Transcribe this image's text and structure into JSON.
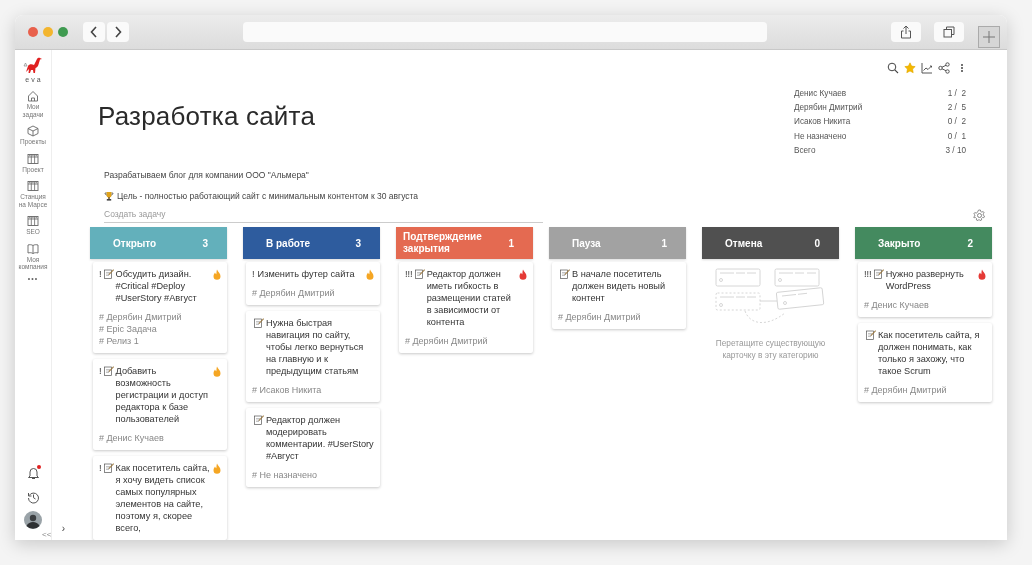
{
  "sidebar": {
    "logo_text": "eva",
    "items": [
      {
        "label": "Мои задачи"
      },
      {
        "label": "Проекты"
      },
      {
        "label": "Проект"
      },
      {
        "label": "Станция на Марсе"
      },
      {
        "label": "SEO"
      },
      {
        "label": "Моя компания"
      }
    ],
    "more": "•••",
    "unread": true,
    "expand": "›",
    "collapse": "<<"
  },
  "project": {
    "title": "Разработка сайта",
    "description": "Разрабатываем блог для компании ООО \"Альмера\"",
    "goal": "Цель - полностью работающий сайт с минимальным контентом к 30 августа"
  },
  "toolbar": {
    "favorite": true
  },
  "stats": [
    {
      "name": "Денис Кучаев",
      "value": "1 /  2"
    },
    {
      "name": "Дерябин Дмитрий",
      "value": "2 /  5"
    },
    {
      "name": "Исаков Никита",
      "value": "0 /  2"
    },
    {
      "name": "Не назначено",
      "value": "0 /  1"
    },
    {
      "name": "Всего",
      "value": "3 / 10"
    }
  ],
  "create_task": {
    "placeholder": "Создать задачу"
  },
  "columns": [
    {
      "title": "Открыто",
      "count": "3",
      "color": "#63b0bb",
      "cards": [
        {
          "priority": "!",
          "memo": true,
          "text": "Обсудить дизайн. #Critical #Deploy #UserStory #Август",
          "tags": [
            "# Дерябин Дмитрий",
            "# Epic Задача",
            "# Релиз 1"
          ],
          "color": "#f5a623"
        },
        {
          "priority": "!",
          "memo": true,
          "text": "Добавить возможность регистрации и доступ редактора к базе пользователей",
          "tags": [
            "# Денис Кучаев"
          ],
          "color": "#f5a623"
        },
        {
          "priority": "!",
          "memo": true,
          "text": "Как посетитель сайта, я хочу видеть список самых популярных элементов на сайте, поэтому я, скорее всего,",
          "color": "#f5a623"
        }
      ]
    },
    {
      "title": "В работе",
      "count": "3",
      "color": "#2e5c9e",
      "cards": [
        {
          "priority": "!",
          "memo": false,
          "text": "Изменить футер сайта",
          "tags": [
            "# Дерябин Дмитрий"
          ],
          "color": "#f5a623"
        },
        {
          "memo": true,
          "text": "Нужна быстрая навигация по сайту, чтобы легко вернуться на главную и к предыдущим статьям",
          "tags": [
            "# Исаков Никита"
          ]
        },
        {
          "memo": true,
          "text": "Редактор должен модерировать комментарии. #UserStory #Август",
          "tags": [
            "# Не назначено"
          ]
        }
      ]
    },
    {
      "title": "Подтверждение закрытия",
      "count": "1",
      "color": "#e46a51",
      "cards": [
        {
          "priority": "!!!",
          "memo": true,
          "text": "Редактор должен иметь гибкость в размещении статей в зависимости от контента",
          "tags": [
            "# Дерябин Дмитрий"
          ],
          "color": "#e53935"
        }
      ]
    },
    {
      "title": "Пауза",
      "count": "1",
      "color": "#a2a2a2",
      "cards": [
        {
          "memo": true,
          "text": "В начале посетитель должен видеть новый контент",
          "tags": [
            "# Дерябин Дмитрий"
          ]
        }
      ]
    },
    {
      "title": "Отмена",
      "count": "0",
      "color": "#505050",
      "empty_hint": "Перетащите существующую карточку в эту категорию"
    },
    {
      "title": "Закрыто",
      "count": "2",
      "color": "#448a5f",
      "cards": [
        {
          "priority": "!!!",
          "memo": true,
          "text": "Нужно развернуть WordPress",
          "tags": [
            "# Денис Кучаев"
          ],
          "color": "#e53935"
        },
        {
          "memo": true,
          "text": "Как посетитель сайта, я должен понимать, как только я захожу, что такое Scrum",
          "tags": [
            "# Дерябин Дмитрий"
          ]
        }
      ]
    }
  ]
}
